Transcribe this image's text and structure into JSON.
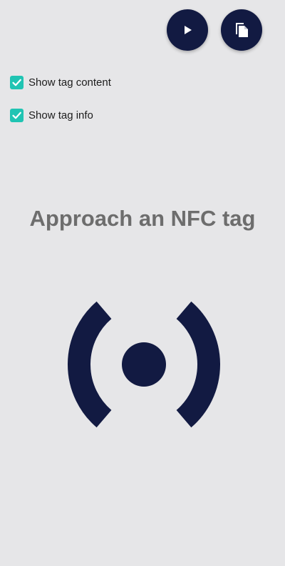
{
  "toolbar": {
    "play_icon": "play-icon",
    "copy_icon": "copy-file-icon",
    "accent": "#121a42"
  },
  "options": {
    "show_tag_content": {
      "label": "Show tag content",
      "checked": true
    },
    "show_tag_info": {
      "label": "Show tag info",
      "checked": true
    },
    "check_color": "#20c4b3"
  },
  "main": {
    "title": "Approach an NFC tag",
    "illustration_icon": "nfc-signal-icon"
  }
}
